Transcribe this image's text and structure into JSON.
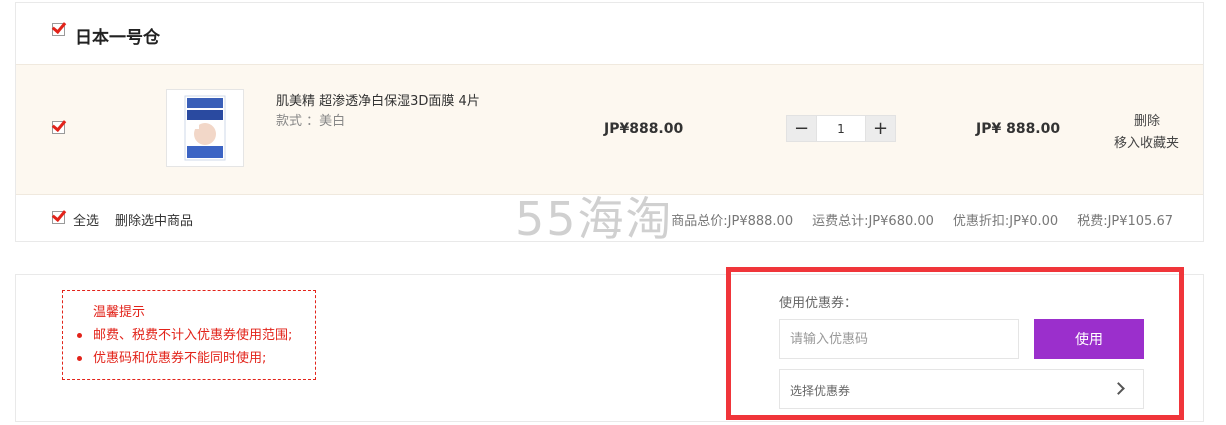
{
  "warehouse": {
    "title": "日本一号仓"
  },
  "item": {
    "name": "肌美精 超渗透净白保湿3D面膜 4片",
    "style": "款式 ：美白",
    "unit_price": "JP¥888.00",
    "quantity": "1",
    "decrement_symbol": "−",
    "increment_symbol": "+",
    "subtotal": "JP¥ 888.00",
    "delete_label": "删除",
    "favorite_label": "移入收藏夹",
    "thumbnail_icon": "product-image-icon"
  },
  "footer": {
    "select_all": "全选",
    "delete_selected": "删除选中商品",
    "goods_total": "商品总价:JP¥888.00",
    "shipping_total": "运费总计:JP¥680.00",
    "discount": "优惠折扣:JP¥0.00",
    "tax": "税费:JP¥105.67"
  },
  "watermark": "55海淘",
  "tips": {
    "title": "温馨提示",
    "items": [
      "邮费、税费不计入优惠券使用范围;",
      "优惠码和优惠券不能同时使用;"
    ]
  },
  "coupon": {
    "label": "使用优惠券：",
    "input_placeholder": "请输入优惠码",
    "use_button": "使用",
    "select_label": "选择优惠券"
  },
  "colors": {
    "accent_purple": "#9b2fcc",
    "highlight_red": "#f0353a",
    "check_red": "#e2231a",
    "row_background": "#fdf8f0"
  }
}
